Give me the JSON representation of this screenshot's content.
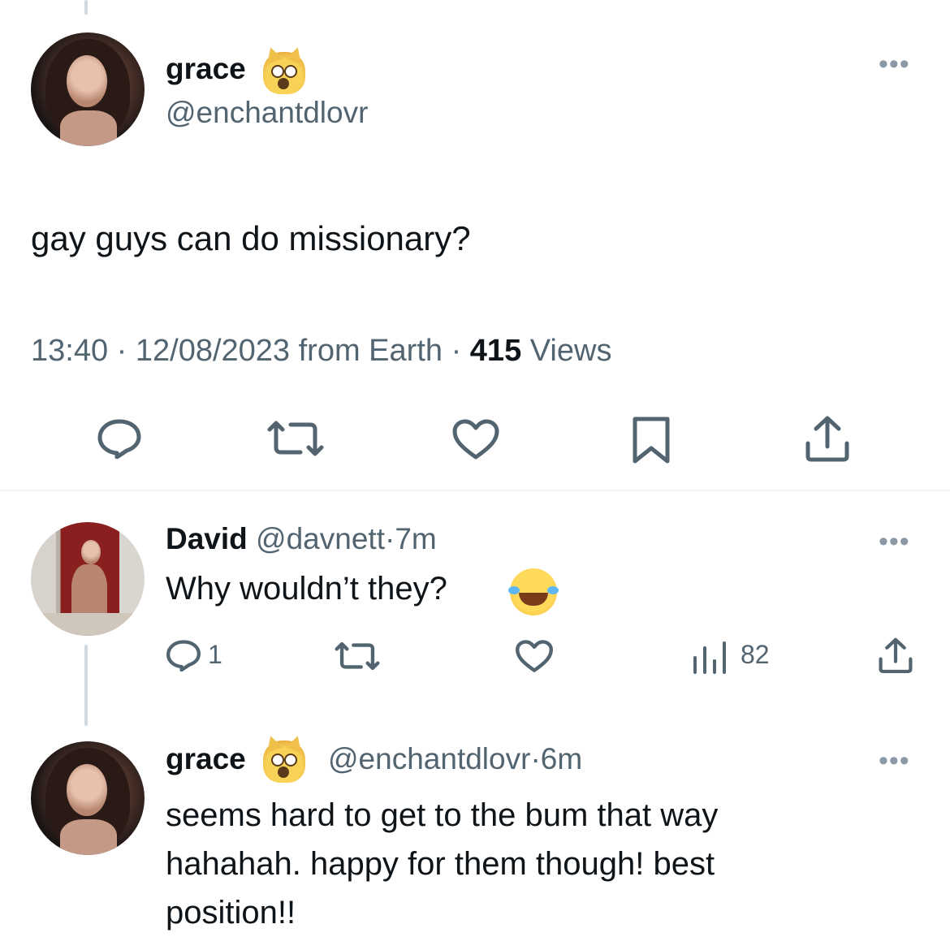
{
  "main_tweet": {
    "display_name": "grace",
    "name_emoji": "scream-cat-emoji",
    "handle": "@enchantdlovr",
    "text": "gay guys can do missionary?",
    "time": "13:40",
    "date": "12/08/2023",
    "location": "from Earth",
    "views_count": "415",
    "views_label": "Views",
    "sep": "·"
  },
  "reply_1": {
    "display_name": "David",
    "handle": "@davnett",
    "sep": "·",
    "age": "7m",
    "text": "Why wouldn’t they?",
    "text_emoji": "laughing-tears-emoji",
    "reply_count": "1",
    "views_count": "82"
  },
  "reply_2": {
    "display_name": "grace",
    "name_emoji": "scream-cat-emoji",
    "handle": "@enchantdlovr",
    "sep": "·",
    "age": "6m",
    "text_lines": [
      "seems hard to get to the bum that way",
      "hahahah. happy for them though! best",
      "position!!"
    ]
  },
  "colors": {
    "text": "#0f1419",
    "muted": "#536471",
    "icon": "#536471",
    "divider": "#eff3f4",
    "thread_line": "#cfd9de"
  }
}
